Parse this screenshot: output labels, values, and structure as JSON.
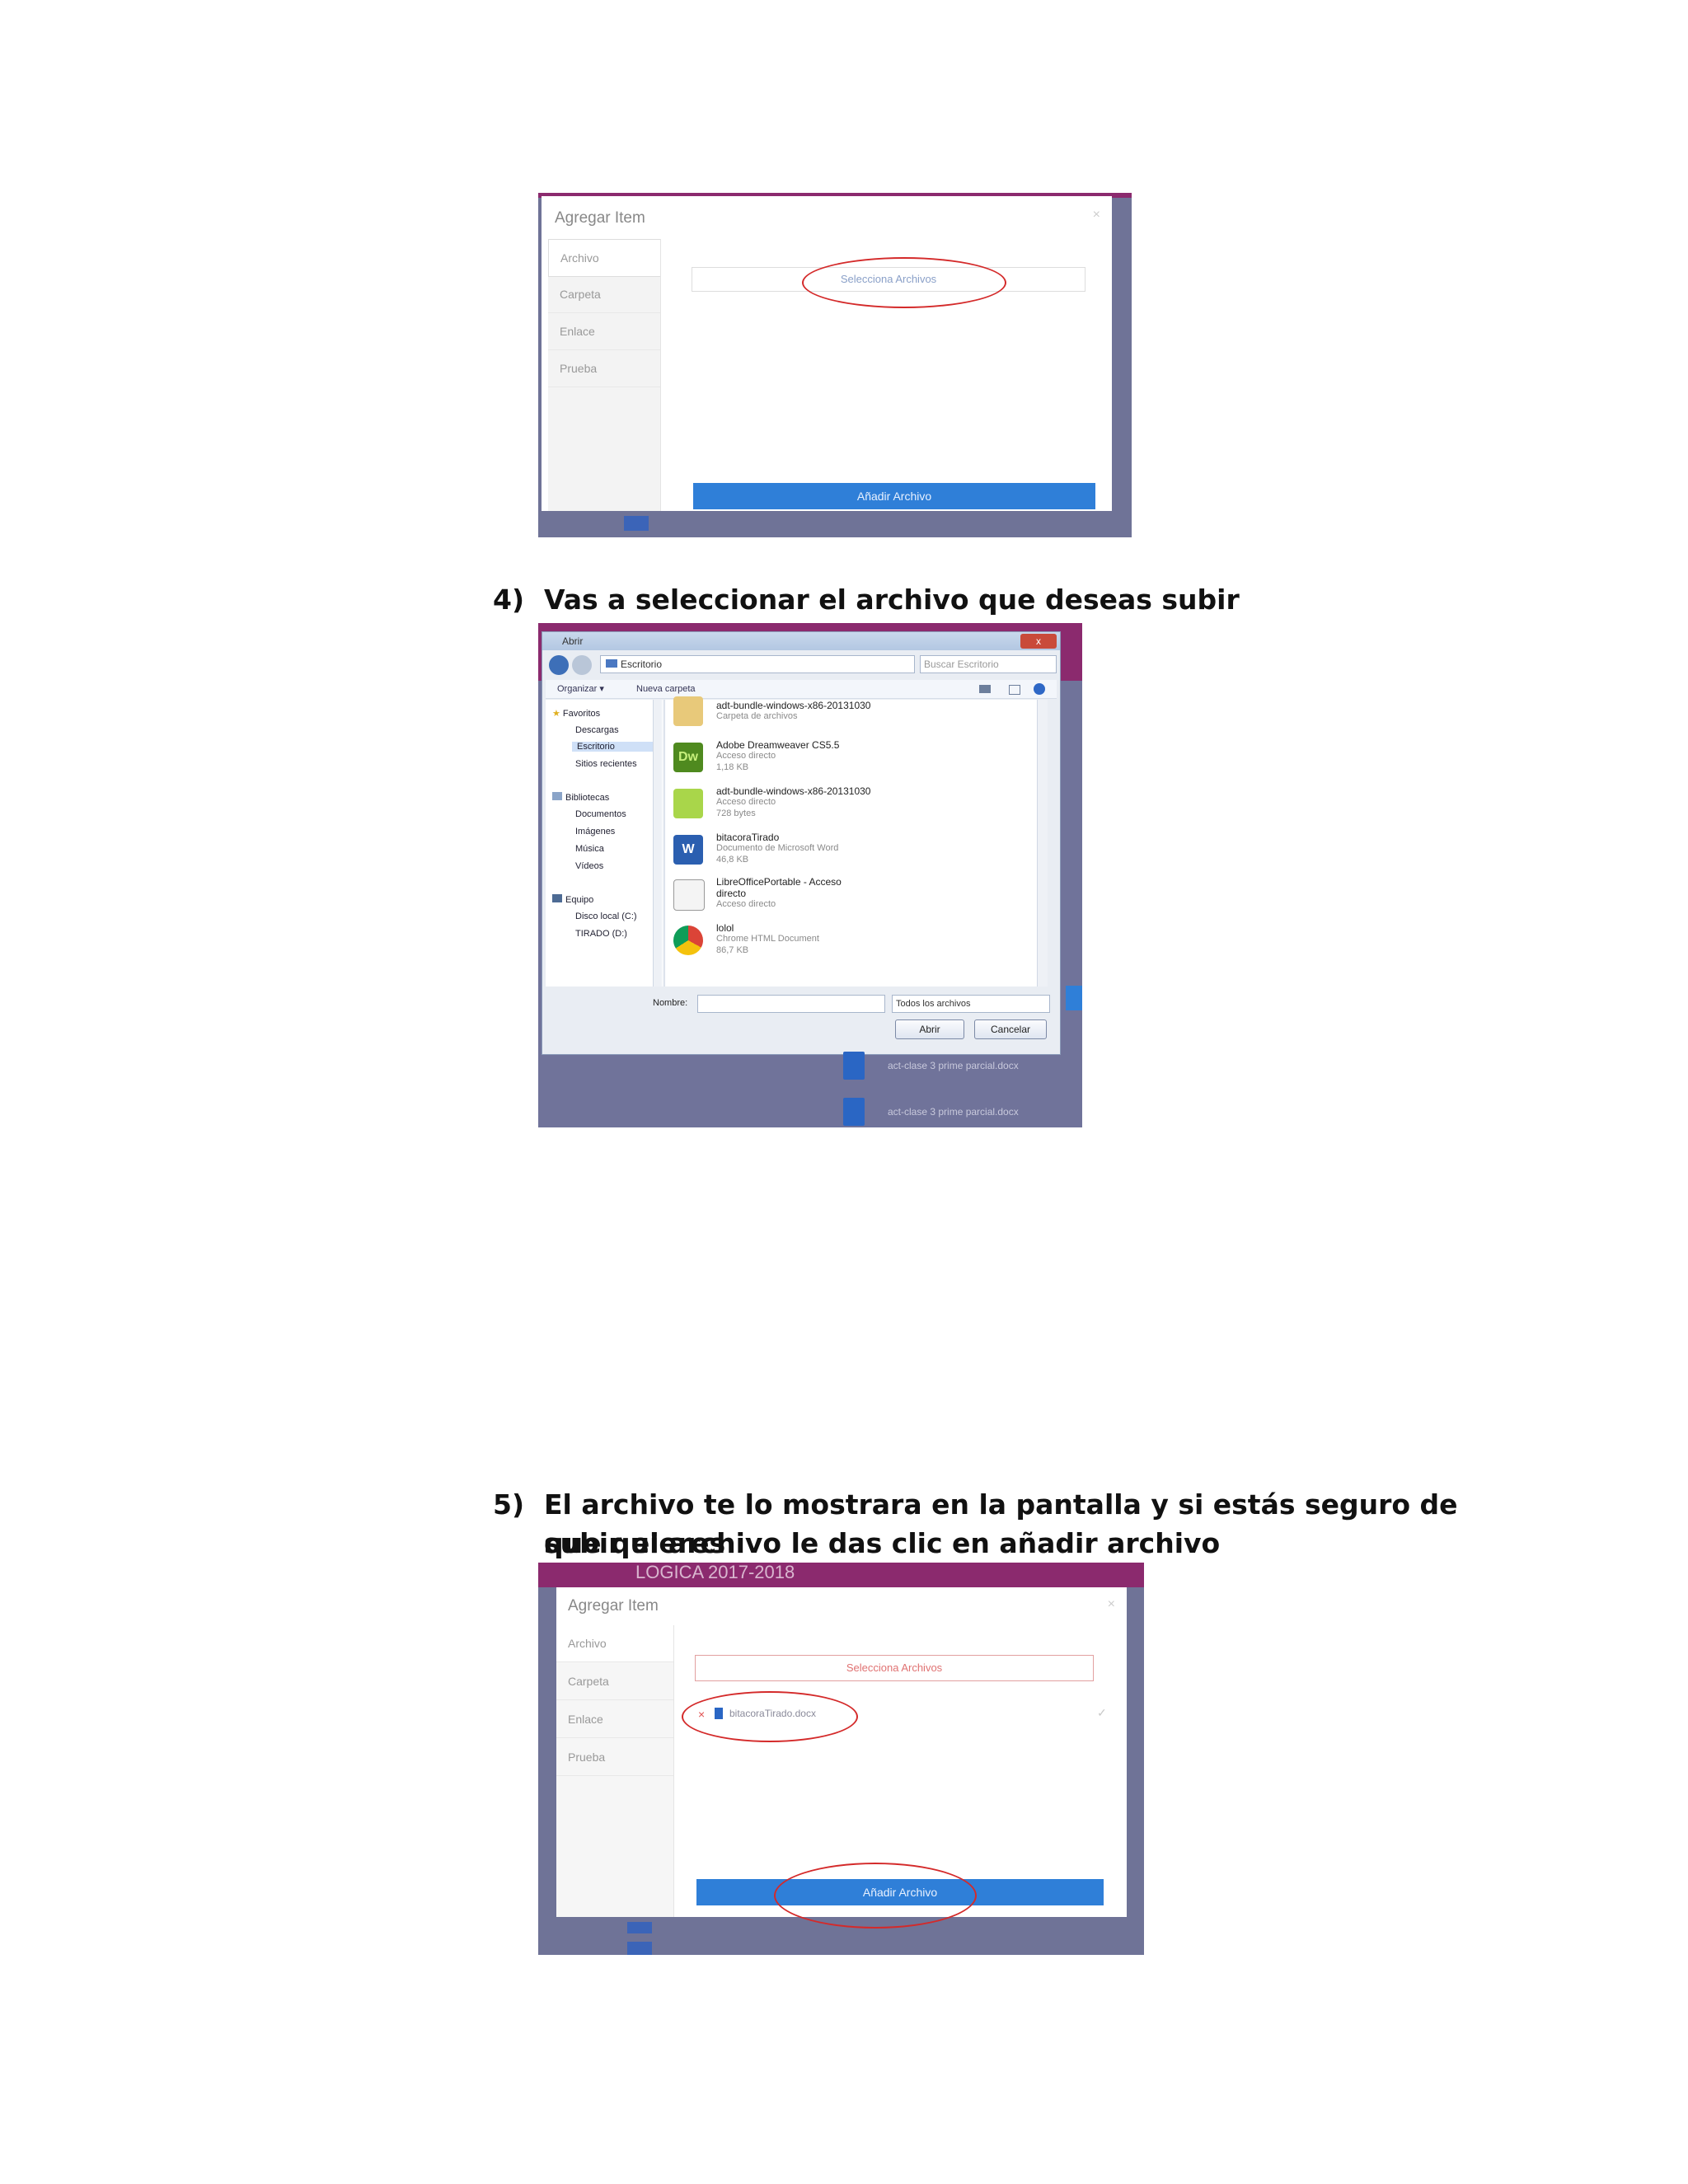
{
  "screenshot_1": {
    "modal_title": "Agregar Item",
    "close": "×",
    "tabs": [
      "Archivo",
      "Carpeta",
      "Enlace",
      "Prueba"
    ],
    "select_button": "Selecciona Archivos",
    "add_button": "Añadir Archivo"
  },
  "step4": {
    "number": "4)",
    "text": "Vas a seleccionar el archivo que deseas subir"
  },
  "dialog": {
    "title": "Abrir",
    "close": "x",
    "address": "Escritorio",
    "search_placeholder": "Buscar Escritorio",
    "organize": "Organizar ▾",
    "new_folder": "Nueva carpeta",
    "nav": {
      "favorites": "Favoritos",
      "fav_items": [
        "Descargas",
        "Escritorio",
        "Sitios recientes"
      ],
      "libraries": "Bibliotecas",
      "lib_items": [
        "Documentos",
        "Imágenes",
        "Música",
        "Vídeos"
      ],
      "computer": "Equipo",
      "comp_items": [
        "Disco local (C:)",
        "TIRADO (D:)"
      ]
    },
    "files": [
      {
        "name": "adt-bundle-windows-x86-20131030",
        "sub1": "Carpeta de archivos",
        "sub2": ""
      },
      {
        "name": "Adobe Dreamweaver CS5.5",
        "sub1": "Acceso directo",
        "sub2": "1,18 KB"
      },
      {
        "name": "adt-bundle-windows-x86-20131030",
        "sub1": "Acceso directo",
        "sub2": "728 bytes"
      },
      {
        "name": "bitacoraTirado",
        "sub1": "Documento de Microsoft Word",
        "sub2": "46,8 KB"
      },
      {
        "name": "LibreOfficePortable - Acceso directo",
        "sub1": "Acceso directo",
        "sub2": ""
      },
      {
        "name": "lolol",
        "sub1": "Chrome HTML Document",
        "sub2": "86,7 KB"
      }
    ],
    "icon_labels": {
      "dreamweaver": "Dw",
      "word": "W"
    },
    "name_label": "Nombre:",
    "filter": "Todos los archivos",
    "open_button": "Abrir",
    "cancel_button": "Cancelar",
    "bg_rows": [
      "act-clase 3 prime parcial.docx",
      "act-clase 3 prime parcial.docx"
    ]
  },
  "step5": {
    "number": "5)",
    "line1": "El archivo te lo mostrara en la pantalla y si estás seguro de que quieres",
    "line2": "subir el archivo le das clic en añadir archivo"
  },
  "screenshot_3": {
    "header_text": "LOGICA 2017-2018",
    "modal_title": "Agregar Item",
    "close": "×",
    "tabs": [
      "Archivo",
      "Carpeta",
      "Enlace",
      "Prueba"
    ],
    "select_button": "Selecciona Archivos",
    "remove": "×",
    "file_name": "bitacoraTirado.docx",
    "check": "✓",
    "add_button": "Añadir Archivo"
  },
  "colors": {
    "accent_blue": "#2f7fd8",
    "annotation_red": "#d42a2a",
    "overlay": "#6f7397",
    "header_magenta": "#8b2a6e"
  }
}
